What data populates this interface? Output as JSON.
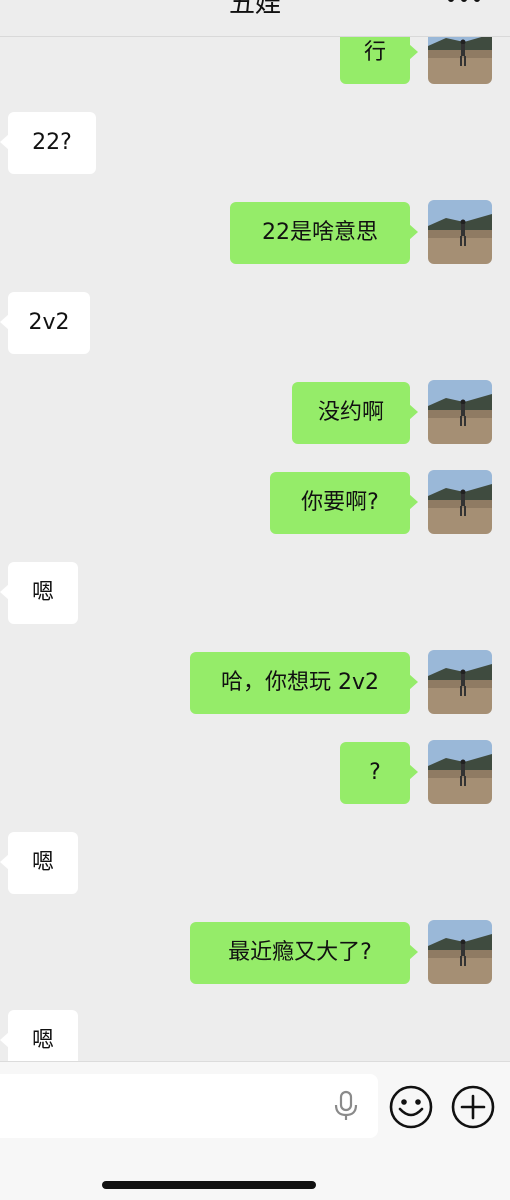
{
  "header": {
    "title": "五娃",
    "more_icon": "more-dots-icon"
  },
  "messages": [
    {
      "side": "out",
      "text": "行"
    },
    {
      "side": "in",
      "text": "22?"
    },
    {
      "side": "out",
      "text": "22是啥意思"
    },
    {
      "side": "in",
      "text": "2v2"
    },
    {
      "side": "out",
      "text": "没约啊"
    },
    {
      "side": "out",
      "text": "你要啊?"
    },
    {
      "side": "in",
      "text": "嗯"
    },
    {
      "side": "out",
      "text": "哈，你想玩 2v2"
    },
    {
      "side": "out",
      "text": "?"
    },
    {
      "side": "in",
      "text": "嗯"
    },
    {
      "side": "out",
      "text": "最近瘾又大了?"
    },
    {
      "side": "in",
      "text": "嗯"
    }
  ],
  "input_bar": {
    "text_value": "",
    "icons": [
      "microphone-icon",
      "emoji-icon",
      "plus-icon"
    ]
  },
  "colors": {
    "background": "#ededed",
    "outgoing": "#95ec69",
    "incoming": "#ffffff"
  }
}
